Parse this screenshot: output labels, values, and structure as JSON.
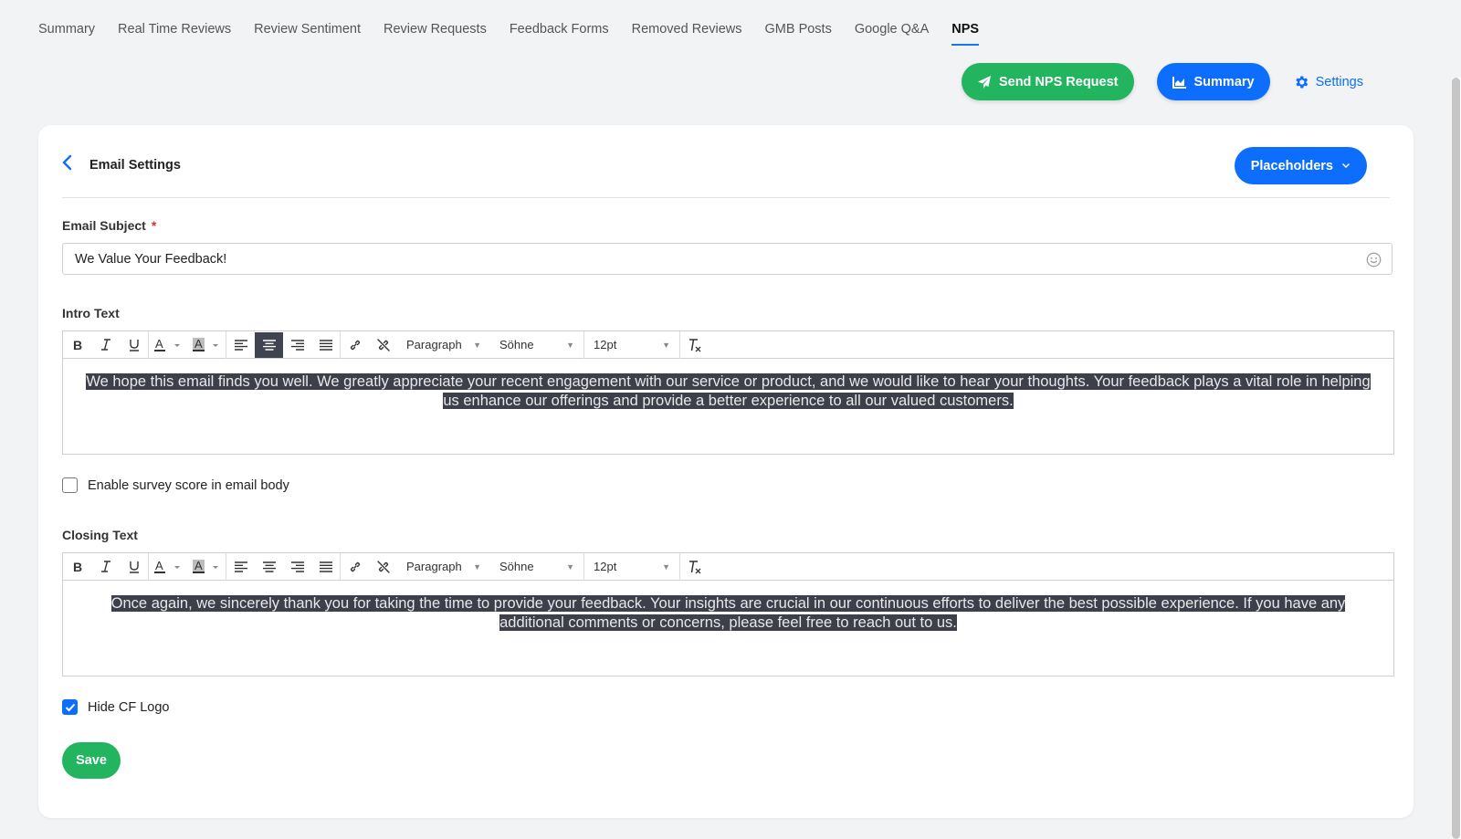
{
  "tabs": [
    {
      "label": "Summary"
    },
    {
      "label": "Real Time Reviews"
    },
    {
      "label": "Review Sentiment"
    },
    {
      "label": "Review Requests"
    },
    {
      "label": "Feedback Forms"
    },
    {
      "label": "Removed Reviews"
    },
    {
      "label": "GMB Posts"
    },
    {
      "label": "Google Q&A"
    },
    {
      "label": "NPS",
      "active": true
    }
  ],
  "actions": {
    "send_nps_label": "Send NPS Request",
    "summary_label": "Summary",
    "settings_label": "Settings"
  },
  "card": {
    "title": "Email Settings",
    "placeholders_label": "Placeholders"
  },
  "subject": {
    "label": "Email Subject",
    "required_mark": "*",
    "value": "We Value Your Feedback!"
  },
  "intro": {
    "label": "Intro Text",
    "text": "We hope this email finds you well. We greatly appreciate your recent engagement with our service or product, and we would like to hear your thoughts. Your feedback plays a vital role in helping us enhance our offerings and provide a better experience to all our valued customers.",
    "alignment": "center"
  },
  "closing": {
    "label": "Closing Text",
    "text": "Once again, we sincerely thank you for taking the time to provide your feedback. Your insights are crucial in our continuous efforts to deliver the best possible experience. If you have any additional comments or concerns, please feel free to reach out to us."
  },
  "toolbar": {
    "block_format": "Paragraph",
    "font_family": "Söhne",
    "font_size": "12pt"
  },
  "survey_score": {
    "label": "Enable survey score in email body",
    "checked": false
  },
  "hide_logo": {
    "label": "Hide CF Logo",
    "checked": true
  },
  "save_label": "Save",
  "colors": {
    "primary_blue": "#0d6efd",
    "green": "#22b45f",
    "selection": "#3d404b"
  }
}
